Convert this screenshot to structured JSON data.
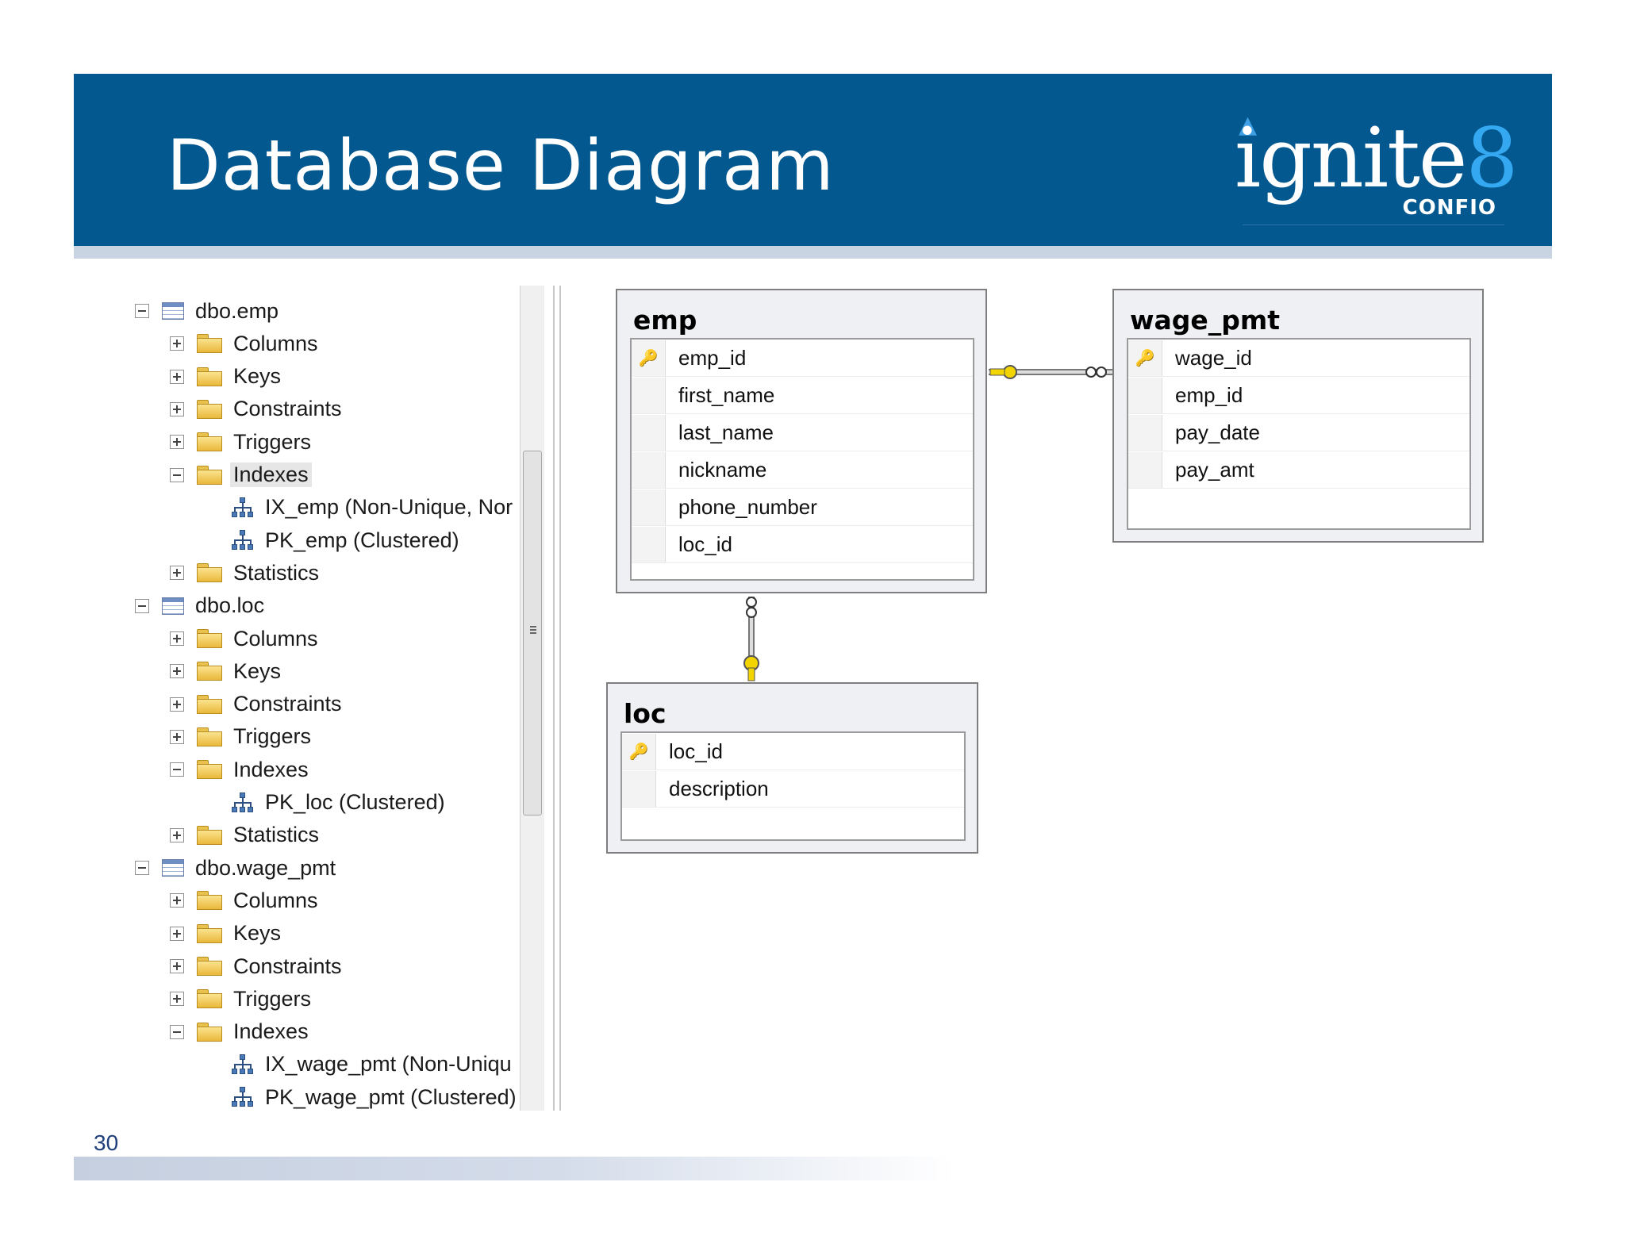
{
  "slide": {
    "title": "Database Diagram",
    "page_number": "30"
  },
  "logo": {
    "word_main": "ignite",
    "word_digit": "8",
    "sub": "CONFIO"
  },
  "tree": {
    "items": [
      {
        "label": "dbo.emp",
        "kind": "table",
        "expander": "minus"
      },
      {
        "label": "Columns",
        "kind": "folder",
        "expander": "plus"
      },
      {
        "label": "Keys",
        "kind": "folder",
        "expander": "plus"
      },
      {
        "label": "Constraints",
        "kind": "folder",
        "expander": "plus"
      },
      {
        "label": "Triggers",
        "kind": "folder",
        "expander": "plus"
      },
      {
        "label": "Indexes",
        "kind": "folder",
        "expander": "minus",
        "selected": true
      },
      {
        "label": "IX_emp (Non-Unique, Nor",
        "kind": "index"
      },
      {
        "label": "PK_emp (Clustered)",
        "kind": "index"
      },
      {
        "label": "Statistics",
        "kind": "folder",
        "expander": "plus"
      },
      {
        "label": "dbo.loc",
        "kind": "table",
        "expander": "minus"
      },
      {
        "label": "Columns",
        "kind": "folder",
        "expander": "plus"
      },
      {
        "label": "Keys",
        "kind": "folder",
        "expander": "plus"
      },
      {
        "label": "Constraints",
        "kind": "folder",
        "expander": "plus"
      },
      {
        "label": "Triggers",
        "kind": "folder",
        "expander": "plus"
      },
      {
        "label": "Indexes",
        "kind": "folder",
        "expander": "minus"
      },
      {
        "label": "PK_loc (Clustered)",
        "kind": "index"
      },
      {
        "label": "Statistics",
        "kind": "folder",
        "expander": "plus"
      },
      {
        "label": "dbo.wage_pmt",
        "kind": "table",
        "expander": "minus"
      },
      {
        "label": "Columns",
        "kind": "folder",
        "expander": "plus"
      },
      {
        "label": "Keys",
        "kind": "folder",
        "expander": "plus"
      },
      {
        "label": "Constraints",
        "kind": "folder",
        "expander": "plus"
      },
      {
        "label": "Triggers",
        "kind": "folder",
        "expander": "plus"
      },
      {
        "label": "Indexes",
        "kind": "folder",
        "expander": "minus"
      },
      {
        "label": "IX_wage_pmt (Non-Uniqu",
        "kind": "index"
      },
      {
        "label": "PK_wage_pmt (Clustered)",
        "kind": "index"
      }
    ]
  },
  "diagram": {
    "emp": {
      "title": "emp",
      "columns": [
        {
          "name": "emp_id",
          "pk": true
        },
        {
          "name": "first_name",
          "pk": false
        },
        {
          "name": "last_name",
          "pk": false
        },
        {
          "name": "nickname",
          "pk": false
        },
        {
          "name": "phone_number",
          "pk": false
        },
        {
          "name": "loc_id",
          "pk": false
        }
      ]
    },
    "wage_pmt": {
      "title": "wage_pmt",
      "columns": [
        {
          "name": "wage_id",
          "pk": true
        },
        {
          "name": "emp_id",
          "pk": false
        },
        {
          "name": "pay_date",
          "pk": false
        },
        {
          "name": "pay_amt",
          "pk": false
        }
      ]
    },
    "loc": {
      "title": "loc",
      "columns": [
        {
          "name": "loc_id",
          "pk": true
        },
        {
          "name": "description",
          "pk": false
        }
      ]
    }
  },
  "colors": {
    "banner": "#03588f",
    "key_yellow": "#f2d400"
  }
}
